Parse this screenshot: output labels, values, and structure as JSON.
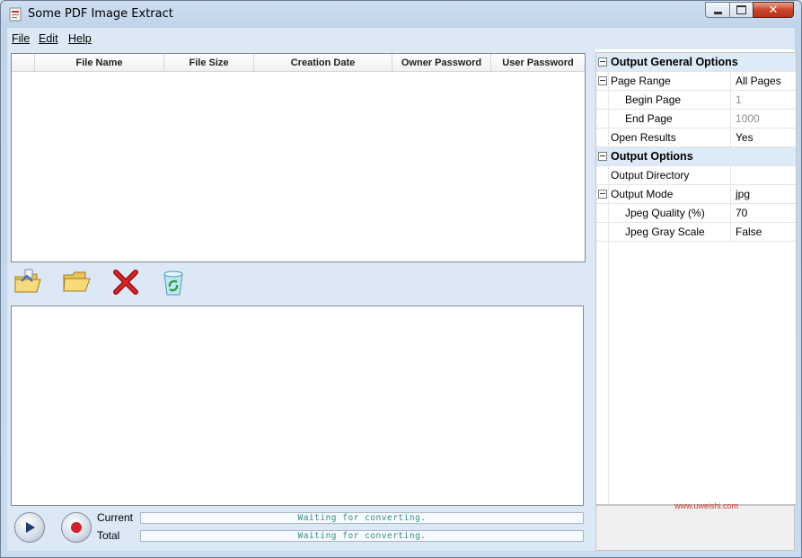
{
  "window": {
    "title": "Some PDF Image Extract"
  },
  "menu": {
    "items": [
      "File",
      "Edit",
      "Help"
    ]
  },
  "file_table": {
    "columns": [
      "",
      "File Name",
      "File Size",
      "Creation Date",
      "Owner Password",
      "User Password"
    ],
    "rows": []
  },
  "toolbar": {
    "buttons": [
      {
        "name": "add-files",
        "icon": "folder-add-icon"
      },
      {
        "name": "open-folder",
        "icon": "folder-open-icon"
      },
      {
        "name": "remove",
        "icon": "red-x-icon"
      },
      {
        "name": "clear-list",
        "icon": "recycle-bin-icon"
      }
    ]
  },
  "progress": {
    "current_label": "Current",
    "total_label": "Total",
    "current_status": "Waiting for converting.",
    "total_status": "Waiting for converting."
  },
  "properties": {
    "rows": [
      {
        "kind": "category",
        "name": "Output General Options"
      },
      {
        "kind": "prop",
        "name": "Page Range",
        "value": "All Pages",
        "expandable": true
      },
      {
        "kind": "sub",
        "name": "Begin Page",
        "value": "1",
        "dim": true
      },
      {
        "kind": "sub",
        "name": "End Page",
        "value": "1000",
        "dim": true
      },
      {
        "kind": "prop",
        "name": "Open Results",
        "value": "Yes"
      },
      {
        "kind": "category",
        "name": "Output Options"
      },
      {
        "kind": "prop",
        "name": "Output Directory",
        "value": ""
      },
      {
        "kind": "prop",
        "name": "Output Mode",
        "value": "jpg",
        "expandable": true
      },
      {
        "kind": "sub",
        "name": "Jpeg Quality (%)",
        "value": "70"
      },
      {
        "kind": "sub",
        "name": "Jpeg Gray Scale",
        "value": "False"
      }
    ]
  },
  "watermark": {
    "url": "www.uweishi.com"
  }
}
